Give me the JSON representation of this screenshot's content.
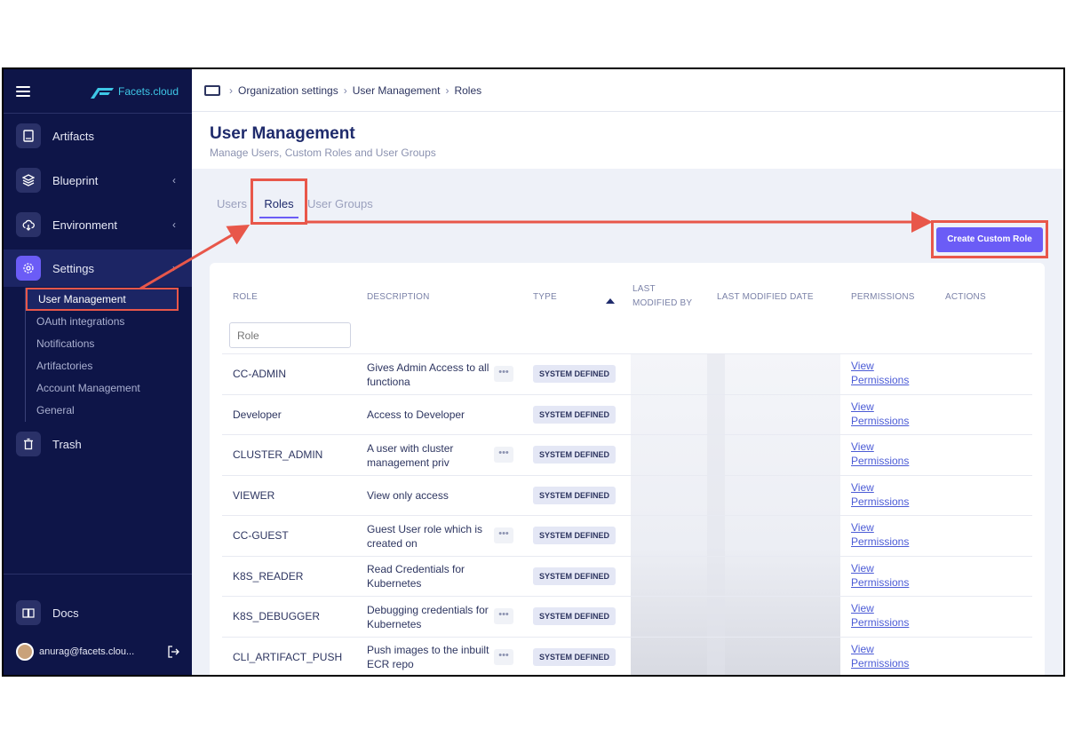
{
  "sidebar": {
    "brand": "Facets.cloud",
    "items": [
      {
        "label": "Artifacts",
        "icon": "book-icon"
      },
      {
        "label": "Blueprint",
        "icon": "layers-icon"
      },
      {
        "label": "Environment",
        "icon": "cloud-icon"
      },
      {
        "label": "Settings",
        "icon": "gear-icon"
      }
    ],
    "subitems": [
      "User Management",
      "OAuth integrations",
      "Notifications",
      "Artifactories",
      "Account Management",
      "General"
    ],
    "trash": "Trash",
    "docs": "Docs",
    "user": "anurag@facets.clou..."
  },
  "breadcrumb": [
    "Organization settings",
    "User Management",
    "Roles"
  ],
  "page": {
    "title": "User Management",
    "subtitle": "Manage Users, Custom Roles and User Groups"
  },
  "tabs": [
    "Users",
    "Roles",
    "User Groups"
  ],
  "create_button": "Create Custom Role",
  "table": {
    "headers": {
      "role": "ROLE",
      "description": "DESCRIPTION",
      "type": "TYPE",
      "last_modified_by_1": "LAST",
      "last_modified_by_2": "MODIFIED BY",
      "last_modified_date": "LAST MODIFIED DATE",
      "permissions": "PERMISSIONS",
      "actions": "ACTIONS"
    },
    "role_filter_placeholder": "Role",
    "rows": [
      {
        "role": "CC-ADMIN",
        "desc": "Gives Admin Access to all functiona",
        "more": true,
        "type": "SYSTEM DEFINED",
        "perm1": "View",
        "perm2": "Permissions"
      },
      {
        "role": "Developer",
        "desc": "Access to Developer",
        "more": false,
        "type": "SYSTEM DEFINED",
        "perm1": "View",
        "perm2": "Permissions"
      },
      {
        "role": "CLUSTER_ADMIN",
        "desc": "A user with cluster management priv",
        "more": true,
        "type": "SYSTEM DEFINED",
        "perm1": "View",
        "perm2": "Permissions"
      },
      {
        "role": "VIEWER",
        "desc": "View only access",
        "more": false,
        "type": "SYSTEM DEFINED",
        "perm1": "View",
        "perm2": "Permissions"
      },
      {
        "role": "CC-GUEST",
        "desc": "Guest User role which is created on",
        "more": true,
        "type": "SYSTEM DEFINED",
        "perm1": "View",
        "perm2": "Permissions"
      },
      {
        "role": "K8S_READER",
        "desc": "Read Credentials for Kubernetes",
        "more": false,
        "type": "SYSTEM DEFINED",
        "perm1": "View",
        "perm2": "Permissions"
      },
      {
        "role": "K8S_DEBUGGER",
        "desc": "Debugging credentials for Kubernetes",
        "more": true,
        "type": "SYSTEM DEFINED",
        "perm1": "View",
        "perm2": "Permissions"
      },
      {
        "role": "CLI_ARTIFACT_PUSH",
        "desc": "Push images to the inbuilt ECR repo",
        "more": true,
        "type": "SYSTEM DEFINED",
        "perm1": "View",
        "perm2": "Permissions"
      }
    ]
  },
  "colors": {
    "sidebar_bg": "#0e1548",
    "accent": "#6b5cf6",
    "annotation": "#e8574a",
    "brand": "#3ec7e6"
  }
}
